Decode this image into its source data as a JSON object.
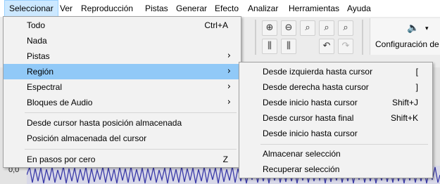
{
  "menubar": {
    "items": [
      {
        "label": "Seleccionar"
      },
      {
        "label": "Ver"
      },
      {
        "label": "Reproducción"
      },
      {
        "label": "Pistas"
      },
      {
        "label": "Generar"
      },
      {
        "label": "Efecto"
      },
      {
        "label": "Analizar"
      },
      {
        "label": "Herramientas"
      },
      {
        "label": "Ayuda"
      }
    ]
  },
  "toolbar": {
    "audio_setup_label": "Configuración de",
    "speaker_icon": "speaker-icon",
    "dropdown_arrow": "▾"
  },
  "track": {
    "value": "0,0"
  },
  "select_menu": {
    "items": [
      {
        "label": "Todo",
        "shortcut": "Ctrl+A"
      },
      {
        "label": "Nada"
      },
      {
        "label": "Pistas",
        "submenu": true
      },
      {
        "label": "Región",
        "submenu": true,
        "highlighted": true
      },
      {
        "label": "Espectral",
        "submenu": true
      },
      {
        "label": "Bloques de Audio",
        "submenu": true
      },
      {
        "label": "Desde cursor hasta posición almacenada"
      },
      {
        "label": "Posición almacenada del cursor"
      },
      {
        "label": "En pasos por cero",
        "shortcut": "Z"
      }
    ]
  },
  "region_submenu": {
    "items": [
      {
        "label": "Desde izquierda hasta cursor",
        "shortcut": "["
      },
      {
        "label": "Desde derecha hasta cursor",
        "shortcut": "]"
      },
      {
        "label": "Desde inicio hasta cursor",
        "shortcut": "Shift+J"
      },
      {
        "label": "Desde cursor hasta final",
        "shortcut": "Shift+K"
      },
      {
        "label": "Desde inicio hasta cursor"
      },
      {
        "label": "Almacenar selección"
      },
      {
        "label": "Recuperar selección"
      }
    ]
  }
}
